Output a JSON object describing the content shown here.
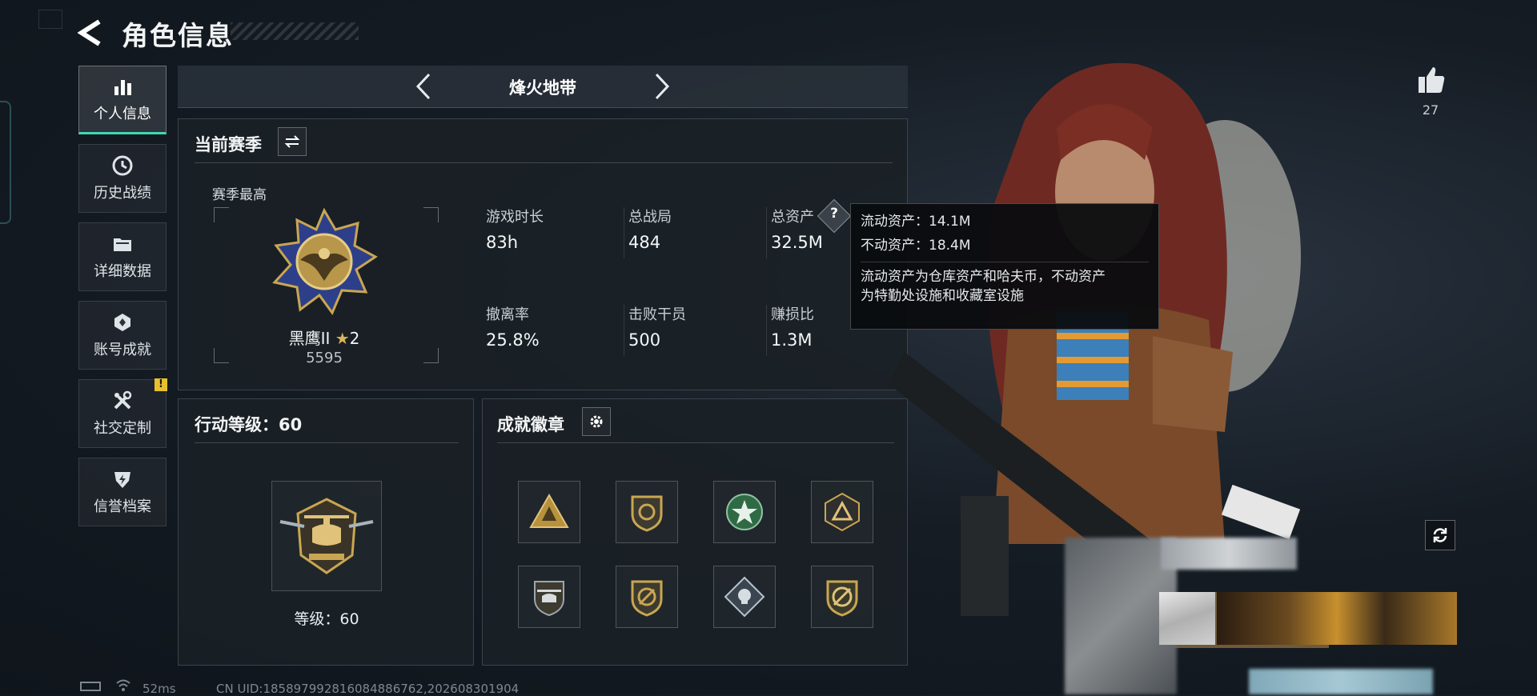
{
  "header": {
    "title": "角色信息"
  },
  "sidebar": {
    "items": [
      {
        "label": "个人信息",
        "icon": "bar-chart-icon",
        "active": true
      },
      {
        "label": "历史战绩",
        "icon": "history-clock-icon"
      },
      {
        "label": "详细数据",
        "icon": "folder-icon"
      },
      {
        "label": "账号成就",
        "icon": "achievement-badge-icon"
      },
      {
        "label": "社交定制",
        "icon": "wrench-tools-icon",
        "alert": "!"
      },
      {
        "label": "信誉档案",
        "icon": "shield-lightning-icon"
      }
    ]
  },
  "mode": {
    "title": "烽火地带"
  },
  "season": {
    "header": "当前赛季",
    "highest_label": "赛季最高",
    "rank_name": "黑鹰II",
    "rank_stars": "2",
    "rank_score": "5595",
    "stats": [
      {
        "label": "游戏时长",
        "value": "83h"
      },
      {
        "label": "总战局",
        "value": "484"
      },
      {
        "label": "总资产",
        "value": "32.5M",
        "help": "?"
      },
      {
        "label": "撤离率",
        "value": "25.8%"
      },
      {
        "label": "击败干员",
        "value": "500"
      },
      {
        "label": "赚损比",
        "value": "1.3M"
      }
    ]
  },
  "tooltip": {
    "liquid": "流动资产：14.1M",
    "fixed": "不动资产：18.4M",
    "desc_1": "流动资产为仓库资产和哈夫币，不动资产",
    "desc_2": "为特勤处设施和收藏室设施"
  },
  "action_level": {
    "header": "行动等级：60",
    "level_text": "等级：60"
  },
  "achievements": {
    "header": "成就徽章",
    "badges": [
      "triangle-emblem-icon",
      "shield-emblem-icon",
      "green-star-medal-icon",
      "dark-triangle-emblem-icon",
      "helicopter-emblem-icon",
      "shield-slash-emblem-icon",
      "diamond-skull-emblem-icon",
      "circle-slash-emblem-icon"
    ]
  },
  "likes": {
    "count": "27"
  },
  "footer": {
    "ping": "52ms",
    "uid": "CN UID:185897992816084886762,202608301904"
  },
  "colors": {
    "accent": "#3fd8b6",
    "gold": "#c9a652",
    "warn": "#e8c02b"
  }
}
